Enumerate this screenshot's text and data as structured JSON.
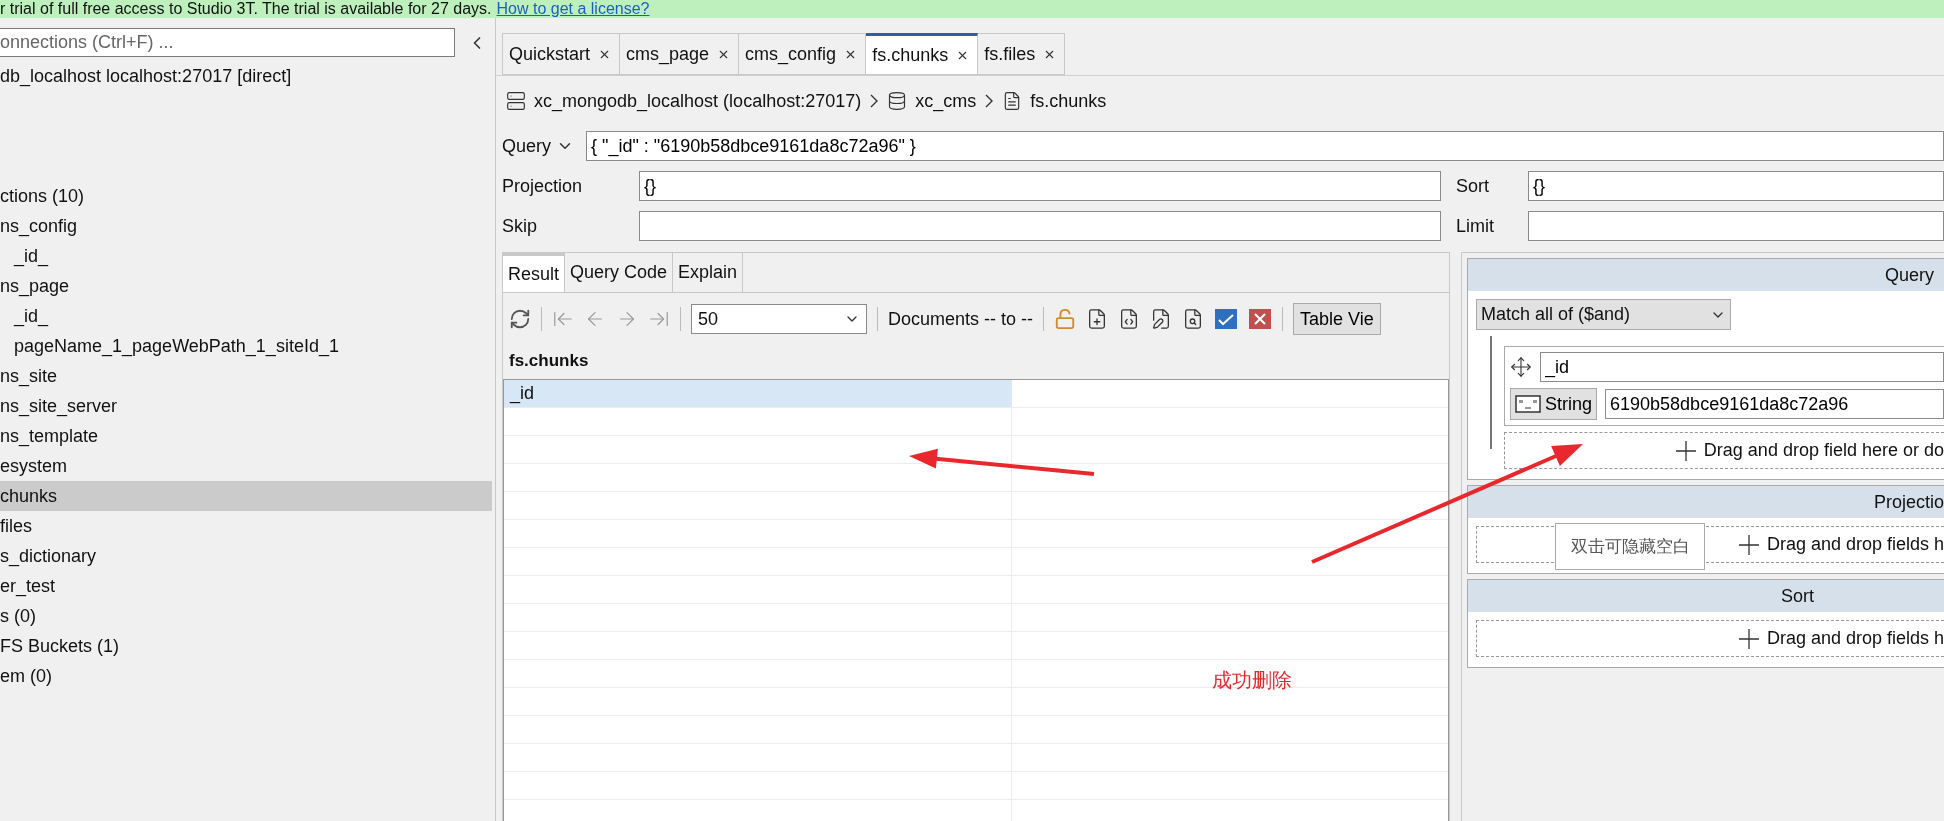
{
  "banner": {
    "text": "r trial of full free access to Studio 3T. The trial is available for 27 days.",
    "link": "How to get a license?"
  },
  "sidebar": {
    "search": {
      "placeholder": "onnections (Ctrl+F) ..."
    },
    "connection": "db_localhost localhost:27017 [direct]",
    "items": [
      {
        "label": "ctions (10)",
        "selected": false
      },
      {
        "label": "ns_config",
        "selected": false,
        "children": [
          {
            "label": "_id_",
            "selected": false
          }
        ]
      },
      {
        "label": "ns_page",
        "selected": false,
        "children": [
          {
            "label": "_id_",
            "selected": false
          },
          {
            "label": "pageName_1_pageWebPath_1_siteId_1",
            "selected": false
          }
        ]
      },
      {
        "label": "ns_site",
        "selected": false
      },
      {
        "label": "ns_site_server",
        "selected": false
      },
      {
        "label": "ns_template",
        "selected": false
      },
      {
        "label": "esystem",
        "selected": false
      },
      {
        "label": "chunks",
        "selected": true
      },
      {
        "label": "files",
        "selected": false
      },
      {
        "label": "s_dictionary",
        "selected": false
      },
      {
        "label": "er_test",
        "selected": false
      },
      {
        "label": "s (0)",
        "selected": false
      },
      {
        "label": "FS Buckets (1)",
        "selected": false
      },
      {
        "label": "em (0)",
        "selected": false
      }
    ]
  },
  "tabs": [
    {
      "label": "Quickstart",
      "selected": false
    },
    {
      "label": "cms_page",
      "selected": false
    },
    {
      "label": "cms_config",
      "selected": false
    },
    {
      "label": "fs.chunks",
      "selected": true
    },
    {
      "label": "fs.files",
      "selected": false
    }
  ],
  "breadcrumb": [
    "xc_mongodb_localhost (localhost:27017)",
    "xc_cms",
    "fs.chunks"
  ],
  "query": {
    "label": "Query",
    "value": "{ \"_id\" : \"6190b58dbce9161da8c72a96\" }"
  },
  "fields": [
    {
      "label": "Projection",
      "value": "{}"
    },
    {
      "label": "Sort",
      "value": "{}"
    },
    {
      "label": "Skip"
    },
    {
      "label": "Limit"
    }
  ],
  "result_tabs": [
    {
      "label": "Result",
      "selected": true
    },
    {
      "label": "Query Code",
      "selected": false
    },
    {
      "label": "Explain",
      "selected": false
    }
  ],
  "result_toolbar": {
    "navigation_disabled": true,
    "page_size": "50",
    "documents": "Documents -- to --",
    "view_button": "Table Vie"
  },
  "result_title": "fs.chunks",
  "table": {
    "columns": [
      {
        "label": "_id",
        "selected": true
      }
    ]
  },
  "visual_query": {
    "query": {
      "title": "Query",
      "match": "Match all of ($and)",
      "field": "_id",
      "type": "String",
      "value": "6190b58dbce9161da8c72a96",
      "drop_hint": "Drag and drop field here or do"
    },
    "projection": {
      "title": "Projectio",
      "drop_hint": "Drag and drop fields h"
    },
    "sort": {
      "title": "Sort",
      "drop_hint": "Drag and drop fields h"
    }
  },
  "tooltip": "双击可隐藏空白",
  "annotation": "成功删除"
}
